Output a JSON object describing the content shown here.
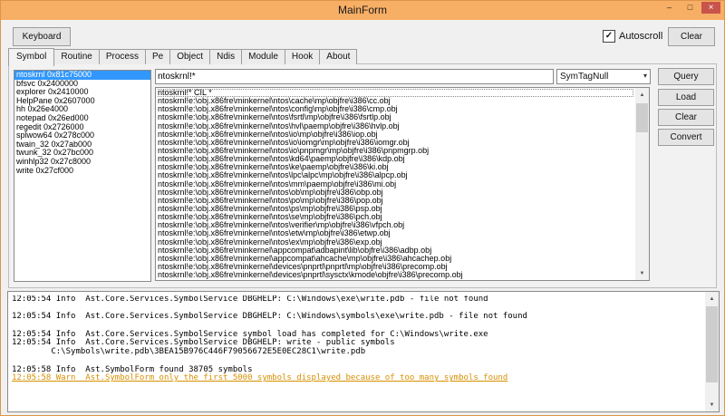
{
  "colors": {
    "titlebar": "#f7ae65",
    "titlebar_border": "#dd9547",
    "close_button": "#c9544b",
    "selection": "#3297fd",
    "warn_text": "#d78f00"
  },
  "icons": {
    "minimize": "–",
    "maximize": "□",
    "close": "×",
    "check": "✓",
    "dropdown_arrow": "▾",
    "scroll_up": "▲",
    "scroll_down": "▼"
  },
  "window": {
    "title": "MainForm"
  },
  "toolbar": {
    "keyboard_label": "Keyboard",
    "autoscroll_label": "Autoscroll",
    "autoscroll_checked": true,
    "clear_label": "Clear"
  },
  "tabs": [
    {
      "label": "Symbol",
      "selected": true
    },
    {
      "label": "Routine"
    },
    {
      "label": "Process"
    },
    {
      "label": "Pe"
    },
    {
      "label": "Object"
    },
    {
      "label": "Ndis"
    },
    {
      "label": "Module"
    },
    {
      "label": "Hook"
    },
    {
      "label": "About"
    }
  ],
  "symbol_tab": {
    "modules": [
      {
        "label": "ntoskrnl 0x81c75000",
        "selected": true
      },
      {
        "label": "bfsvc 0x2400000"
      },
      {
        "label": "explorer 0x2410000"
      },
      {
        "label": "HelpPane 0x2607000"
      },
      {
        "label": "hh 0x26e4000"
      },
      {
        "label": "notepad 0x26ed000"
      },
      {
        "label": "regedit 0x2726000"
      },
      {
        "label": "splwow64 0x278c000"
      },
      {
        "label": "twain_32 0x27ab000"
      },
      {
        "label": "twunk_32 0x27bc000"
      },
      {
        "label": "winhlp32 0x27c8000"
      },
      {
        "label": "write 0x27cf000"
      }
    ],
    "filter": {
      "value": "ntoskrnl!*"
    },
    "symtag_combo": {
      "value": "SymTagNull"
    },
    "buttons": {
      "query": "Query",
      "load": "Load",
      "clear": "Clear",
      "convert": "Convert"
    },
    "results": [
      "ntoskrnl!* CIL *",
      "ntoskrnl!e:\\obj.x86fre\\minkernel\\ntos\\cache\\mp\\objfre\\i386\\cc.obj",
      "ntoskrnl!e:\\obj.x86fre\\minkernel\\ntos\\config\\mp\\objfre\\i386\\cmp.obj",
      "ntoskrnl!e:\\obj.x86fre\\minkernel\\ntos\\fsrtl\\mp\\objfre\\i386\\fsrtlp.obj",
      "ntoskrnl!e:\\obj.x86fre\\minkernel\\ntos\\hvl\\paemp\\objfre\\i386\\hvlp.obj",
      "ntoskrnl!e:\\obj.x86fre\\minkernel\\ntos\\io\\mp\\objfre\\i386\\iop.obj",
      "ntoskrnl!e:\\obj.x86fre\\minkernel\\ntos\\io\\iomgr\\mp\\objfre\\i386\\iomgr.obj",
      "ntoskrnl!e:\\obj.x86fre\\minkernel\\ntos\\io\\pnpmgr\\mp\\objfre\\i386\\pnpmgrp.obj",
      "ntoskrnl!e:\\obj.x86fre\\minkernel\\ntos\\kd64\\paemp\\objfre\\i386\\kdp.obj",
      "ntoskrnl!e:\\obj.x86fre\\minkernel\\ntos\\ke\\paemp\\objfre\\i386\\ki.obj",
      "ntoskrnl!e:\\obj.x86fre\\minkernel\\ntos\\lpc\\alpc\\mp\\objfre\\i386\\alpcp.obj",
      "ntoskrnl!e:\\obj.x86fre\\minkernel\\ntos\\mm\\paemp\\objfre\\i386\\mi.obj",
      "ntoskrnl!e:\\obj.x86fre\\minkernel\\ntos\\ob\\mp\\objfre\\i386\\obp.obj",
      "ntoskrnl!e:\\obj.x86fre\\minkernel\\ntos\\po\\mp\\objfre\\i386\\pop.obj",
      "ntoskrnl!e:\\obj.x86fre\\minkernel\\ntos\\ps\\mp\\objfre\\i386\\psp.obj",
      "ntoskrnl!e:\\obj.x86fre\\minkernel\\ntos\\se\\mp\\objfre\\i386\\pch.obj",
      "ntoskrnl!e:\\obj.x86fre\\minkernel\\ntos\\verifier\\mp\\objfre\\i386\\vfpch.obj",
      "ntoskrnl!e:\\obj.x86fre\\minkernel\\ntos\\etw\\mp\\objfre\\i386\\etwp.obj",
      "ntoskrnl!e:\\obj.x86fre\\minkernel\\ntos\\ex\\mp\\objfre\\i386\\exp.obj",
      "ntoskrnl!e:\\obj.x86fre\\minkernel\\appcompat\\adbapint\\lib\\objfre\\i386\\adbp.obj",
      "ntoskrnl!e:\\obj.x86fre\\minkernel\\appcompat\\ahcache\\mp\\objfre\\i386\\ahcachep.obj",
      "ntoskrnl!e:\\obj.x86fre\\minkernel\\devices\\pnprtl\\pnprtl\\mp\\objfre\\i386\\precomp.obj",
      "ntoskrnl!e:\\obj.x86fre\\minkernel\\devices\\pnprtl\\sysctx\\kmode\\objfre\\i386\\precomp.obj"
    ]
  },
  "log": {
    "lines": [
      {
        "text": "12:05:54 Info  Ast.Core.Services.SymbolService DBGHELP: C:\\Windows\\exe\\write.pdb - file not found",
        "level": "info"
      },
      {
        "text": "",
        "level": ""
      },
      {
        "text": "12:05:54 Info  Ast.Core.Services.SymbolService DBGHELP: C:\\Windows\\symbols\\exe\\write.pdb - file not found",
        "level": "info"
      },
      {
        "text": "",
        "level": ""
      },
      {
        "text": "12:05:54 Info  Ast.Core.Services.SymbolService symbol load has completed for C:\\Windows\\write.exe",
        "level": "info"
      },
      {
        "text": "12:05:54 Info  Ast.Core.Services.SymbolService DBGHELP: write - public symbols",
        "level": "info"
      },
      {
        "text": "        C:\\Symbols\\write.pdb\\3BEA15B976C446F79056672E5E0EC28C1\\write.pdb",
        "level": "info"
      },
      {
        "text": "",
        "level": ""
      },
      {
        "text": "12:05:58 Info  Ast.SymbolForm found 38705 symbols",
        "level": "info"
      },
      {
        "text": "12:05:58 Warn  Ast.SymbolForm only the first 5000 symbols displayed because of too many symbols found",
        "level": "warn"
      }
    ]
  }
}
